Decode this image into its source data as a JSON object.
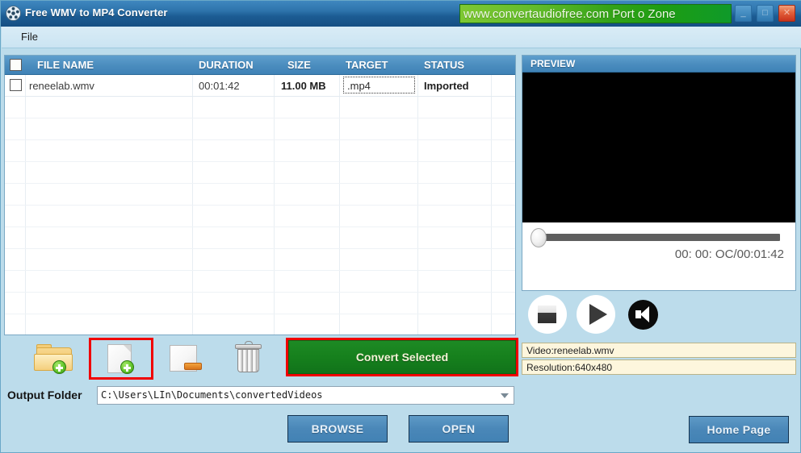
{
  "window": {
    "title": "Free WMV to MP4 Converter",
    "app_icon": "film-reel-icon",
    "banner_text": "www.convertaudiofree.com Port o Zone",
    "minimize_label": "_",
    "maximize_label": "□",
    "close_label": "✕"
  },
  "menu": {
    "items": [
      {
        "label": "File"
      }
    ]
  },
  "file_list": {
    "columns": [
      {
        "key": "check",
        "label": ""
      },
      {
        "key": "name",
        "label": "FILE NAME"
      },
      {
        "key": "duration",
        "label": "DURATION"
      },
      {
        "key": "size",
        "label": "SIZE"
      },
      {
        "key": "target",
        "label": "TARGET"
      },
      {
        "key": "status",
        "label": "STATUS"
      }
    ],
    "rows": [
      {
        "checked": false,
        "name": "reneelab.wmv",
        "duration": "00:01:42",
        "size": "11.00 MB",
        "target": ".mp4",
        "status": "Imported"
      }
    ]
  },
  "preview": {
    "header": "PREVIEW",
    "time_display": "00: 00: OC/00:01:42",
    "seek_position_percent": 0,
    "controls": [
      {
        "name": "stop-button",
        "label": "Stop"
      },
      {
        "name": "play-button",
        "label": "Play"
      },
      {
        "name": "volume-button",
        "label": "Volume"
      }
    ],
    "info": {
      "video": "Video:reneelab.wmv",
      "resolution": "Resolution:640x480"
    }
  },
  "toolbar": {
    "add_folder_label": "Add Folder",
    "add_file_label": "Add File",
    "clear_label": "Clear",
    "delete_label": "Delete",
    "convert_label": "Convert Selected"
  },
  "output": {
    "label": "Output Folder",
    "path": "C:\\Users\\LIn\\Documents\\convertedVideos"
  },
  "buttons": {
    "browse": "BROWSE",
    "open": "OPEN",
    "home_page": "Home Page"
  },
  "colors": {
    "titlebar_blue": "#2e74ac",
    "header_blue": "#4a8cbe",
    "panel_bg": "#bcdceb",
    "convert_green": "#16801d",
    "highlight_red": "#f00000",
    "info_yellow": "#fdf6dd"
  }
}
